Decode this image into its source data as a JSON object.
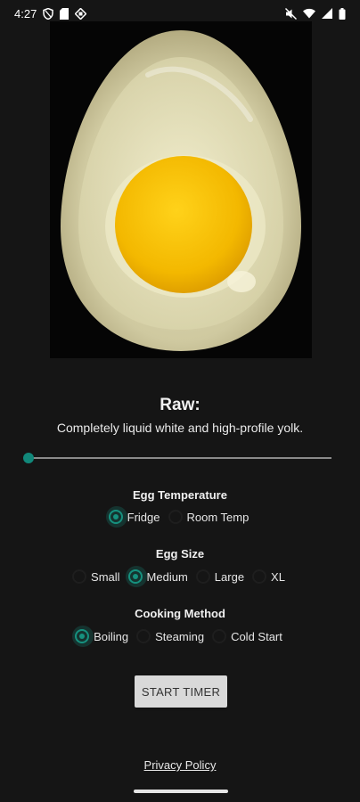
{
  "status_bar": {
    "time": "4:27"
  },
  "egg_image": {
    "alt": "raw egg"
  },
  "stage": {
    "title": "Raw:",
    "description": "Completely liquid white and high-profile yolk."
  },
  "doneness_slider": {
    "value_fraction": 0.0
  },
  "egg_temperature": {
    "label": "Egg Temperature",
    "options": [
      {
        "label": "Fridge",
        "checked": true
      },
      {
        "label": "Room Temp",
        "checked": false
      }
    ]
  },
  "egg_size": {
    "label": "Egg Size",
    "options": [
      {
        "label": "Small",
        "checked": false
      },
      {
        "label": "Medium",
        "checked": true
      },
      {
        "label": "Large",
        "checked": false
      },
      {
        "label": "XL",
        "checked": false
      }
    ]
  },
  "cooking_method": {
    "label": "Cooking Method",
    "options": [
      {
        "label": "Boiling",
        "checked": true
      },
      {
        "label": "Steaming",
        "checked": false
      },
      {
        "label": "Cold Start",
        "checked": false
      }
    ]
  },
  "start_button": {
    "label": "START TIMER"
  },
  "privacy_link": {
    "label": "Privacy Policy"
  },
  "colors": {
    "accent": "#16917f",
    "background": "#151515",
    "button_bg": "#d9d9d9"
  }
}
